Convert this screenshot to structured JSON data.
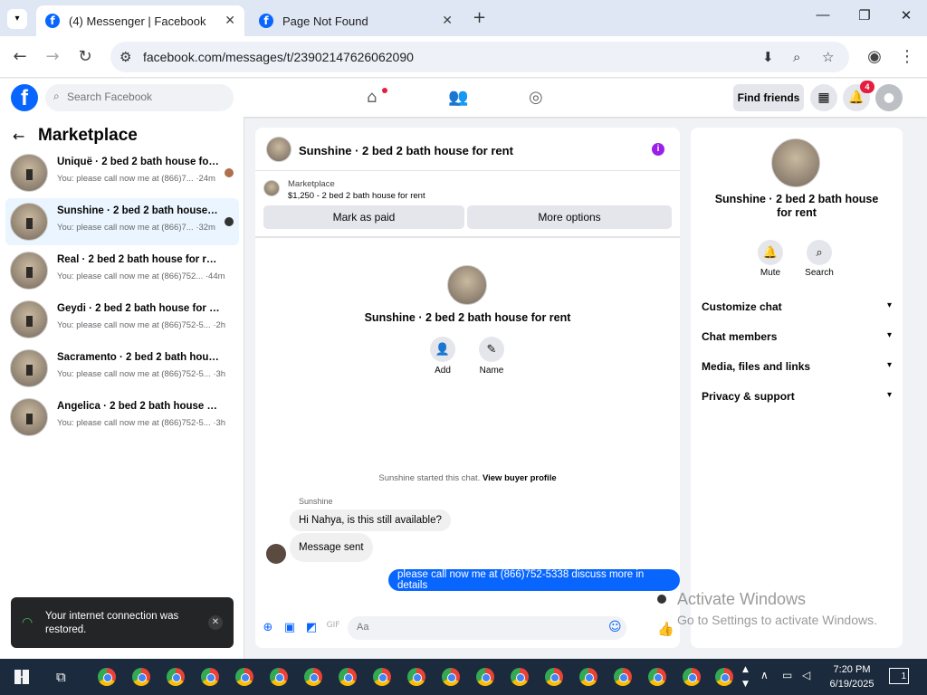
{
  "browser": {
    "tabs": [
      {
        "title": "(4) Messenger | Facebook",
        "active": true
      },
      {
        "title": "Page Not Found",
        "active": false
      }
    ],
    "url": "facebook.com/messages/t/23902147626062090"
  },
  "fb": {
    "search_placeholder": "Search Facebook",
    "find_friends": "Find friends",
    "notif_count": "4",
    "brand_color": "#0866ff"
  },
  "left": {
    "title": "Marketplace",
    "conversations": [
      {
        "name": "Uniquë · 2 bed 2 bath house for rent",
        "preview": "You: please call now me at (866)7... ·24m"
      },
      {
        "name": "Sunshine · 2 bed 2 bath house for rent",
        "preview": "You: please call now me at (866)7... ·32m",
        "selected": true
      },
      {
        "name": "Real · 2 bed 2 bath house for rent",
        "preview": "You: please call now me at (866)752... ·44m"
      },
      {
        "name": "Geydi · 2 bed 2 bath house for rent",
        "preview": "You: please call now me at (866)752-5... ·2h"
      },
      {
        "name": "Sacramento · 2 bed 2 bath house for rent",
        "preview": "You: please call now me at (866)752-5... ·3h"
      },
      {
        "name": "Angelica · 2 bed 2 bath house for rent",
        "preview": "You: please call now me at (866)752-5... ·3h"
      }
    ]
  },
  "chat": {
    "title": "Sunshine · 2 bed 2 bath house for rent",
    "marketplace_label": "Marketplace",
    "listing": "$1,250 - 2 bed 2 bath house for rent",
    "mark_paid": "Mark as paid",
    "more_options": "More options",
    "profile_name": "Sunshine · 2 bed 2 bath house for rent",
    "add_label": "Add",
    "name_label": "Name",
    "started_text": "Sunshine started this chat.",
    "view_profile": "View buyer profile",
    "sender_name": "Sunshine",
    "msg1": "Hi Nahya, is this still available?",
    "msg2": "Message sent",
    "msg3": "please call now me at (866)752-5338 discuss more in details",
    "composer_placeholder": "Aa"
  },
  "right": {
    "name": "Sunshine · 2 bed 2 bath house for rent",
    "mute": "Mute",
    "search": "Search",
    "sections": [
      "Customize chat",
      "Chat members",
      "Media, files and links",
      "Privacy & support"
    ]
  },
  "toast": {
    "text": "Your internet connection was restored."
  },
  "watermark": {
    "line1": "Activate Windows",
    "line2": "Go to Settings to activate Windows."
  },
  "taskbar": {
    "time": "7:20 PM",
    "date": "6/19/2025",
    "notif": "1"
  }
}
